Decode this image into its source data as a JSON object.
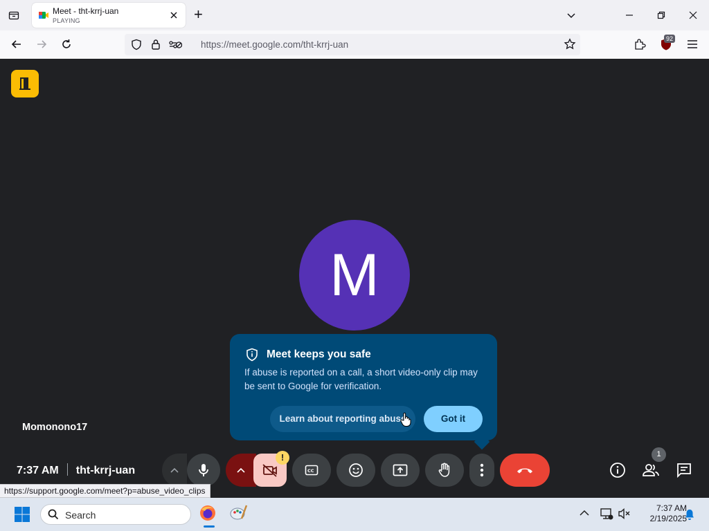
{
  "browser": {
    "tab": {
      "title": "Meet - tht-krrj-uan",
      "status": "PLAYING"
    },
    "new_tab": "+",
    "url_host": "https://meet.google.com",
    "url_path": "/tht-krrj-uan",
    "extension_badge": "92",
    "status_url": "https://support.google.com/meet?p=abuse_video_clips"
  },
  "meet": {
    "avatar_letter": "M",
    "participant_name": "Momonono17",
    "time": "7:37 AM",
    "meeting_code": "tht-krrj-uan",
    "participants_badge": "1",
    "tooltip": {
      "title": "Meet keeps you safe",
      "body": "If abuse is reported on a call, a short video-only clip may be sent to Google for verification.",
      "learn_label": "Learn about reporting abuse",
      "got_it_label": "Got it"
    },
    "warning_badge": "!"
  },
  "taskbar": {
    "search_label": "Search",
    "time": "7:37 AM",
    "date": "2/19/2025"
  },
  "colors": {
    "meet_bg": "#202124",
    "avatar": "#5531b5",
    "tooltip_bg": "#004a77",
    "got_it": "#7fcfff",
    "end_call": "#ea4335",
    "door_icon_bg": "#fbbc04"
  }
}
